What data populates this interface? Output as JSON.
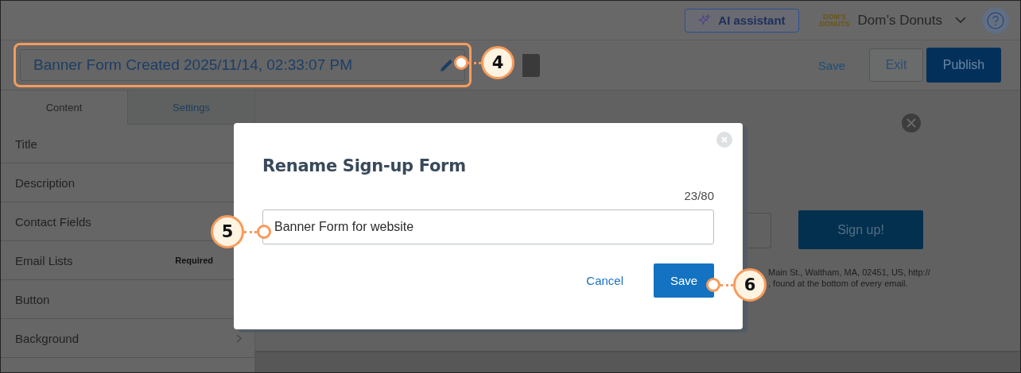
{
  "top_bar": {
    "ai_button": "AI assistant",
    "logo_lines": [
      "DOM'S",
      "DONUTS"
    ],
    "account_name": "Dom’s Donuts"
  },
  "toolbar": {
    "form_name": "Banner Form Created 2025/11/14, 02:33:07 PM",
    "save": "Save",
    "exit": "Exit",
    "publish": "Publish"
  },
  "sidebar": {
    "tabs": [
      {
        "label": "Content",
        "selected": true
      },
      {
        "label": "Settings",
        "selected": false
      }
    ],
    "items": [
      {
        "label": "Title"
      },
      {
        "label": "Description"
      },
      {
        "label": "Contact Fields"
      },
      {
        "label": "Email Lists",
        "badge": "Required"
      },
      {
        "label": "Button"
      },
      {
        "label": "Background",
        "has_arrow": true
      }
    ]
  },
  "preview": {
    "button": "Sign up!",
    "footer_lines": [
      "Main St., Waltham, MA, 02451, US, http://",
      ", found at the bottom of every email."
    ]
  },
  "dialog": {
    "title": "Rename Sign-up Form",
    "counter": "23/80",
    "value": "Banner Form for website",
    "cancel": "Cancel",
    "save": "Save"
  },
  "callouts": [
    "4",
    "5",
    "6"
  ]
}
